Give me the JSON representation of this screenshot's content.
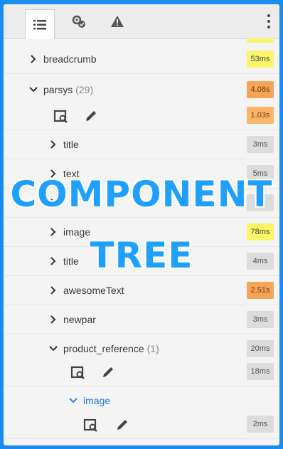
{
  "tabs": [
    {
      "name": "tree-list-icon",
      "active": true
    },
    {
      "name": "settings-check-icon",
      "active": false
    },
    {
      "name": "warning-icon",
      "active": false
    }
  ],
  "more_icon": "more-vertical-icon",
  "rows": [
    {
      "label": "breadcrumb",
      "count": "",
      "badge": "53ms"
    },
    {
      "label": "parsys",
      "count": "(29)",
      "badge": "4.08s"
    },
    {
      "label": "",
      "count": "",
      "badge": "1.03s"
    },
    {
      "label": "title",
      "count": "",
      "badge": "3ms"
    },
    {
      "label": "text",
      "count": "",
      "badge": "5ms"
    },
    {
      "label": "",
      "count": "",
      "badge": "ns"
    },
    {
      "label": "image",
      "count": "",
      "badge": "78ms"
    },
    {
      "label": "title",
      "count": "",
      "badge": "4ms"
    },
    {
      "label": "awesomeText",
      "count": "",
      "badge": "2.51s"
    },
    {
      "label": "newpar",
      "count": "",
      "badge": "3ms"
    },
    {
      "label": "product_reference",
      "count": "(1)",
      "badge": "20ms"
    },
    {
      "label": "",
      "count": "",
      "badge": "18ms"
    },
    {
      "label": "image",
      "count": "",
      "badge": ""
    },
    {
      "label": "",
      "count": "",
      "badge": "2ms"
    }
  ],
  "watermark": {
    "line1": "COMPONENT",
    "line2": "TREE"
  },
  "colors": {
    "accent_blue": "#1a8bf0",
    "yellow": "#fbf56a",
    "orange": "#f7a459",
    "gray": "#dcdcdc"
  }
}
